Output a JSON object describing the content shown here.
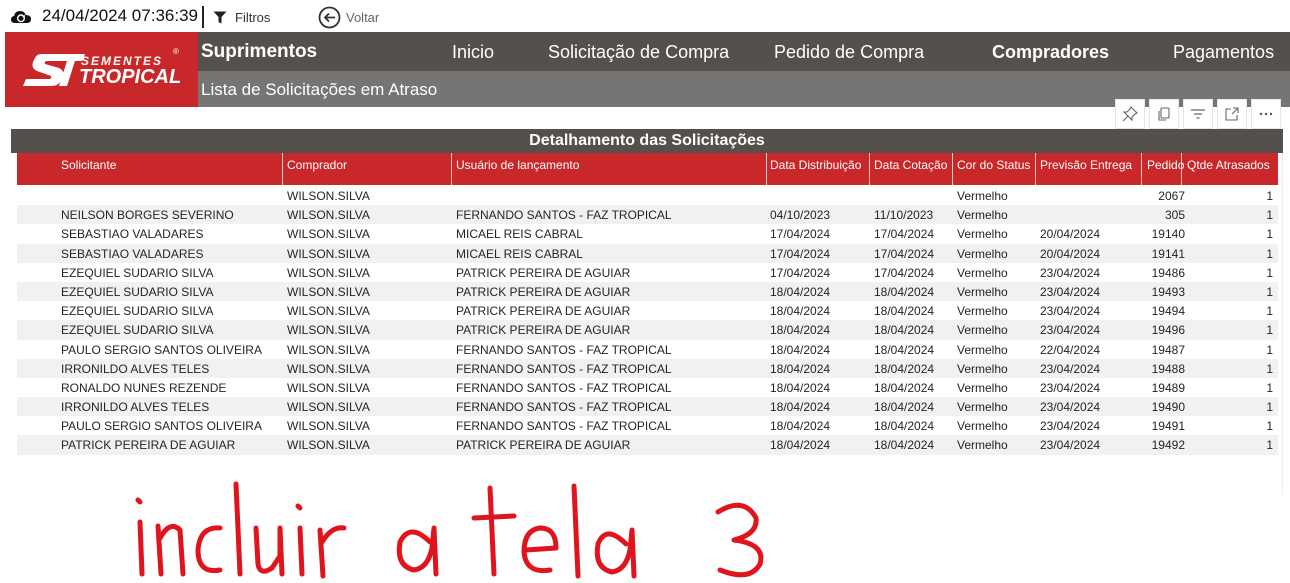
{
  "toolbar": {
    "timestamp": "24/04/2024 07:36:39",
    "filters_label": "Filtros",
    "back_label": "Voltar",
    "icons": [
      "refresh-icon",
      "filter-icon",
      "back-arrow-icon"
    ]
  },
  "brand": {
    "line1": "SEMENTES",
    "line2": "TROPICAL",
    "mark": "ST",
    "registered": "®",
    "color": "#c8282a"
  },
  "header": {
    "section_title": "Suprimentos",
    "page_subtitle": "Lista de Solicitações em Atraso",
    "nav": [
      {
        "label": "Inicio",
        "bold": false
      },
      {
        "label": "Solicitação de Compra",
        "bold": false
      },
      {
        "label": "Pedido de Compra",
        "bold": false
      },
      {
        "label": "Compradores",
        "bold": true
      },
      {
        "label": "Pagamentos",
        "bold": false
      }
    ]
  },
  "visual_header": {
    "icons": [
      "pin-icon",
      "copy-icon",
      "filter-lines-icon",
      "focus-mode-icon",
      "more-options-icon"
    ]
  },
  "table": {
    "title": "Detalhamento das Solicitações",
    "columns": [
      "Solicitante",
      "Comprador",
      "Usuário de lançamento",
      "Data Distribuição",
      "Data Cotação",
      "Cor do Status",
      "Previsão Entrega",
      "Pedido",
      "Qtde Atrasados"
    ],
    "rows": [
      [
        "",
        "WILSON.SILVA",
        "",
        "",
        "",
        "Vermelho",
        "",
        "2067",
        "1"
      ],
      [
        "NEILSON BORGES SEVERINO",
        "WILSON.SILVA",
        "FERNANDO SANTOS - FAZ TROPICAL",
        "04/10/2023",
        "11/10/2023",
        "Vermelho",
        "",
        "305",
        "1"
      ],
      [
        "SEBASTIAO VALADARES",
        "WILSON.SILVA",
        "MICAEL REIS CABRAL",
        "17/04/2024",
        "17/04/2024",
        "Vermelho",
        "20/04/2024",
        "19140",
        "1"
      ],
      [
        "SEBASTIAO VALADARES",
        "WILSON.SILVA",
        "MICAEL REIS CABRAL",
        "17/04/2024",
        "17/04/2024",
        "Vermelho",
        "20/04/2024",
        "19141",
        "1"
      ],
      [
        "EZEQUIEL SUDARIO SILVA",
        "WILSON.SILVA",
        "PATRICK PEREIRA DE AGUIAR",
        "17/04/2024",
        "17/04/2024",
        "Vermelho",
        "23/04/2024",
        "19486",
        "1"
      ],
      [
        "EZEQUIEL SUDARIO SILVA",
        "WILSON.SILVA",
        "PATRICK PEREIRA DE AGUIAR",
        "18/04/2024",
        "18/04/2024",
        "Vermelho",
        "23/04/2024",
        "19493",
        "1"
      ],
      [
        "EZEQUIEL SUDARIO SILVA",
        "WILSON.SILVA",
        "PATRICK PEREIRA DE AGUIAR",
        "18/04/2024",
        "18/04/2024",
        "Vermelho",
        "23/04/2024",
        "19494",
        "1"
      ],
      [
        "EZEQUIEL SUDARIO SILVA",
        "WILSON.SILVA",
        "PATRICK PEREIRA DE AGUIAR",
        "18/04/2024",
        "18/04/2024",
        "Vermelho",
        "23/04/2024",
        "19496",
        "1"
      ],
      [
        "PAULO SERGIO SANTOS OLIVEIRA",
        "WILSON.SILVA",
        "FERNANDO SANTOS - FAZ TROPICAL",
        "18/04/2024",
        "18/04/2024",
        "Vermelho",
        "22/04/2024",
        "19487",
        "1"
      ],
      [
        "IRRONILDO ALVES TELES",
        "WILSON.SILVA",
        "FERNANDO SANTOS - FAZ TROPICAL",
        "18/04/2024",
        "18/04/2024",
        "Vermelho",
        "23/04/2024",
        "19488",
        "1"
      ],
      [
        "RONALDO NUNES REZENDE",
        "WILSON.SILVA",
        "FERNANDO SANTOS - FAZ TROPICAL",
        "18/04/2024",
        "18/04/2024",
        "Vermelho",
        "23/04/2024",
        "19489",
        "1"
      ],
      [
        "IRRONILDO ALVES TELES",
        "WILSON.SILVA",
        "FERNANDO SANTOS - FAZ TROPICAL",
        "18/04/2024",
        "18/04/2024",
        "Vermelho",
        "23/04/2024",
        "19490",
        "1"
      ],
      [
        "PAULO SERGIO SANTOS OLIVEIRA",
        "WILSON.SILVA",
        "FERNANDO SANTOS - FAZ TROPICAL",
        "18/04/2024",
        "18/04/2024",
        "Vermelho",
        "23/04/2024",
        "19491",
        "1"
      ],
      [
        "PATRICK PEREIRA DE AGUIAR",
        "WILSON.SILVA",
        "PATRICK PEREIRA DE AGUIAR",
        "18/04/2024",
        "18/04/2024",
        "Vermelho",
        "23/04/2024",
        "19492",
        "1"
      ]
    ]
  },
  "annotation": {
    "text": "incluir a tela 3",
    "color": "#e0141c"
  }
}
